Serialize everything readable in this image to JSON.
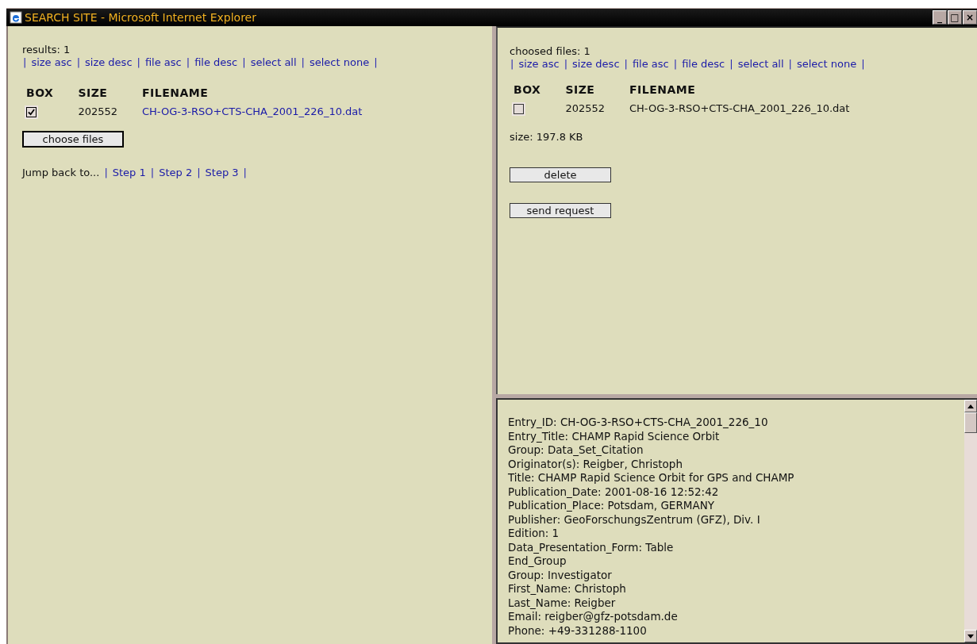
{
  "window": {
    "title": "SEARCH SITE - Microsoft Internet Explorer",
    "buttons": [
      "_",
      "□",
      "×"
    ]
  },
  "results": {
    "count_label": "results: 1",
    "sort_bar": [
      {
        "kind": "sep",
        "text": "|"
      },
      {
        "kind": "link",
        "text": "size asc"
      },
      {
        "kind": "sep",
        "text": "|"
      },
      {
        "kind": "link",
        "text": "size desc"
      },
      {
        "kind": "sep",
        "text": "|"
      },
      {
        "kind": "link",
        "text": "file asc"
      },
      {
        "kind": "sep",
        "text": "|"
      },
      {
        "kind": "link",
        "text": "file desc"
      },
      {
        "kind": "sep",
        "text": "|"
      },
      {
        "kind": "link",
        "text": "select all"
      },
      {
        "kind": "sep",
        "text": "|"
      },
      {
        "kind": "link",
        "text": "select none"
      },
      {
        "kind": "sep",
        "text": "|"
      }
    ],
    "columns": [
      "BOX",
      "SIZE",
      "FILENAME"
    ],
    "rows": [
      {
        "checked": true,
        "size": "202552",
        "filename": "CH-OG-3-RSO+CTS-CHA_2001_226_10.dat",
        "link": true
      }
    ],
    "button": "choose files",
    "jump_bar": [
      {
        "kind": "text",
        "text": "Jump back to..."
      },
      {
        "kind": "sep",
        "text": "|"
      },
      {
        "kind": "link",
        "text": "Step 1"
      },
      {
        "kind": "sep",
        "text": "|"
      },
      {
        "kind": "link",
        "text": "Step 2"
      },
      {
        "kind": "sep",
        "text": "|"
      },
      {
        "kind": "link",
        "text": "Step 3"
      },
      {
        "kind": "sep",
        "text": "|"
      }
    ]
  },
  "chosen": {
    "count_label": "choosed files: 1",
    "sort_bar": [
      {
        "kind": "sep",
        "text": "|"
      },
      {
        "kind": "link",
        "text": "size asc"
      },
      {
        "kind": "sep",
        "text": "|"
      },
      {
        "kind": "link",
        "text": "size desc"
      },
      {
        "kind": "sep",
        "text": "|"
      },
      {
        "kind": "link",
        "text": "file asc"
      },
      {
        "kind": "sep",
        "text": "|"
      },
      {
        "kind": "link",
        "text": "file desc"
      },
      {
        "kind": "sep",
        "text": "|"
      },
      {
        "kind": "link",
        "text": "select all"
      },
      {
        "kind": "sep",
        "text": "|"
      },
      {
        "kind": "link",
        "text": "select none"
      },
      {
        "kind": "sep",
        "text": "|"
      }
    ],
    "columns": [
      "BOX",
      "SIZE",
      "FILENAME"
    ],
    "rows": [
      {
        "checked": false,
        "size": "202552",
        "filename": "CH-OG-3-RSO+CTS-CHA_2001_226_10.dat",
        "link": false
      }
    ],
    "total_size": "size: 197.8 KB",
    "buttons": [
      "delete",
      "send request"
    ]
  },
  "metadata": {
    "lines": [
      "Entry_ID: CH-OG-3-RSO+CTS-CHA_2001_226_10",
      "Entry_Title: CHAMP Rapid Science Orbit",
      "Group: Data_Set_Citation",
      "Originator(s): Reigber, Christoph",
      "Title: CHAMP Rapid Science Orbit for GPS and CHAMP",
      "Publication_Date: 2001-08-16 12:52:42",
      "Publication_Place: Potsdam, GERMANY",
      "Publisher: GeoForschungsZentrum (GFZ), Div. I",
      "Edition: 1",
      "Data_Presentation_Form: Table",
      "End_Group",
      "Group: Investigator",
      "First_Name: Christoph",
      "Last_Name: Reigber",
      "Email: reigber@gfz-potsdam.de",
      "Phone: +49-331288-1100"
    ]
  }
}
